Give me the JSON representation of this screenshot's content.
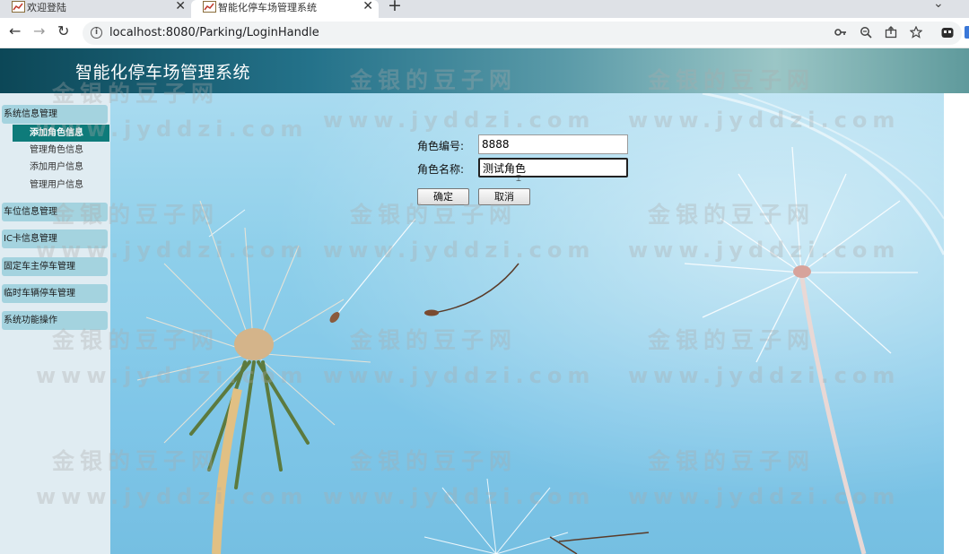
{
  "browser": {
    "tabs": [
      {
        "title": "欢迎登陆",
        "active": false
      },
      {
        "title": "智能化停车场管理系统",
        "active": true
      }
    ],
    "new_tab": "+",
    "tab_menu": "⌄",
    "address": "localhost:8080/Parking/LoginHandle",
    "close_glyph": "✕",
    "back_glyph": "←",
    "forward_glyph": "→",
    "reload_glyph": "↻",
    "info_glyph": "i"
  },
  "header": {
    "title": "智能化停车场管理系统"
  },
  "sidebar": {
    "categories": [
      {
        "label": "系统信息管理"
      },
      {
        "label": "车位信息管理"
      },
      {
        "label": "IC卡信息管理"
      },
      {
        "label": "固定车主停车管理"
      },
      {
        "label": "临时车辆停车管理"
      },
      {
        "label": "系统功能操作"
      }
    ],
    "sub_items": [
      {
        "label": "添加角色信息",
        "active": true
      },
      {
        "label": "管理角色信息",
        "active": false
      },
      {
        "label": "添加用户信息",
        "active": false
      },
      {
        "label": "管理用户信息",
        "active": false
      }
    ]
  },
  "form": {
    "role_id_label": "角色编号:",
    "role_id_value": "8888",
    "role_name_label": "角色名称:",
    "role_name_value": "测试角色",
    "confirm_label": "确定",
    "cancel_label": "取消"
  },
  "watermark": {
    "cn": "金银的豆子网",
    "url": "www.jyddzi.com"
  },
  "colors": {
    "header_start": "#0c4757",
    "sidebar_bg": "#e0ecf2",
    "menu_category_bg": "#a4d3df",
    "menu_active_bg": "#0e7b7a",
    "sky": "#8ecfea"
  }
}
